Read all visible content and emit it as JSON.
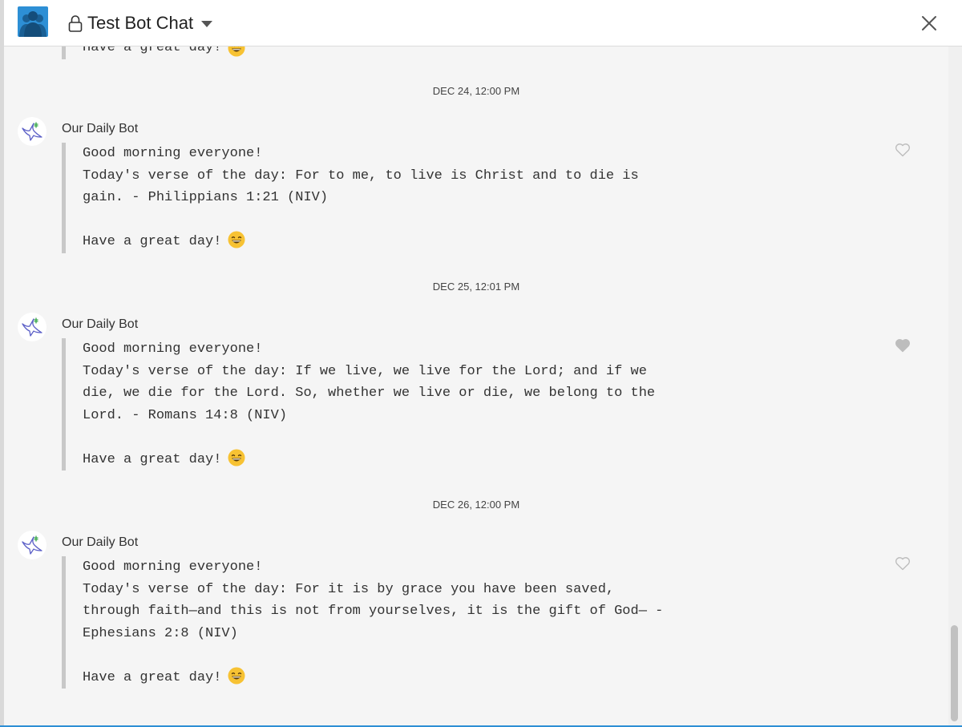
{
  "header": {
    "title": "Test Bot Chat",
    "icons": {
      "room": "group-icon",
      "lock": "lock-icon",
      "menu": "chevron-down-icon",
      "close": "close-icon"
    }
  },
  "colors": {
    "accent": "#2d8fd5",
    "quote_bar": "#c8c8c8",
    "timeline_bg": "#f5f5f5"
  },
  "partial": {
    "text": "Have a great day!"
  },
  "timeline": [
    {
      "date": "DEC 24, 12:00 PM",
      "sender": "Our Daily Bot",
      "greeting": "Good morning everyone!",
      "verse_lines": [
        "Today's verse of the day: For to me, to live is Christ and to die is",
        "gain. - Philippians 1:21 (NIV)"
      ],
      "closing": "Have a great day!",
      "liked": false
    },
    {
      "date": "DEC 25, 12:01 PM",
      "sender": "Our Daily Bot",
      "greeting": "Good morning everyone!",
      "verse_lines": [
        "Today's verse of the day: If we live, we live for the Lord; and if we",
        "die, we die for the Lord. So, whether we live or die, we belong to the",
        "Lord. - Romans 14:8 (NIV)"
      ],
      "closing": "Have a great day!",
      "liked": true
    },
    {
      "date": "DEC 26, 12:00 PM",
      "sender": "Our Daily Bot",
      "greeting": "Good morning everyone!",
      "verse_lines": [
        "Today's verse of the day: For it is by grace you have been saved,",
        "through faith—and this is not from yourselves, it is the gift of God— -",
        "Ephesians 2:8 (NIV)"
      ],
      "closing": "Have a great day!",
      "liked": false
    }
  ]
}
